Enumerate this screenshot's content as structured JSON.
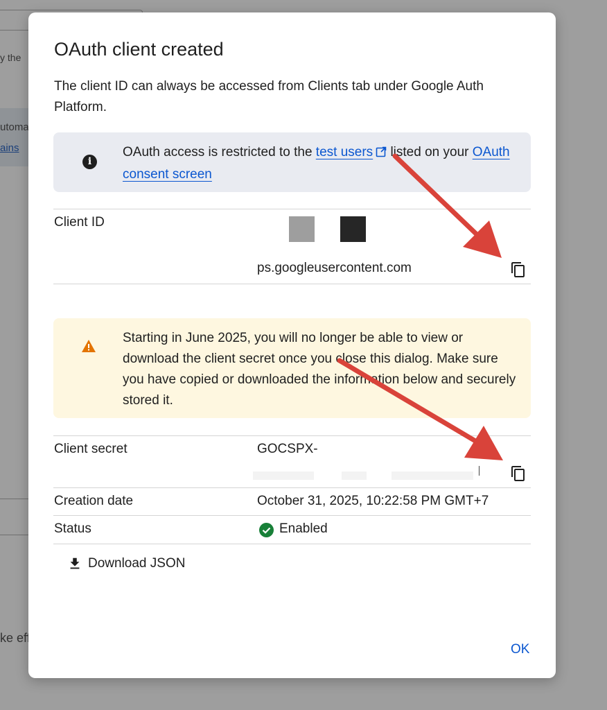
{
  "background": {
    "frag_1": "y the",
    "frag_2": "utoma",
    "frag_3": "ains",
    "frag_4": "ke eff"
  },
  "dialog": {
    "title": "OAuth client created",
    "description": "The client ID can always be accessed from Clients tab under Google Auth Platform.",
    "info": {
      "text_1": "OAuth access is restricted to the",
      "test_users_link": "test users",
      "text_2": "listed on your",
      "consent_link": "OAuth consent screen"
    },
    "client_id": {
      "label": "Client ID",
      "value": "ps.googleusercontent.com"
    },
    "warning": {
      "text": "Starting in June 2025, you will no longer be able to view or download the client secret once you close this dialog. Make sure you have copied or downloaded the information below and securely stored it."
    },
    "client_secret": {
      "label": "Client secret",
      "value": "GOCSPX-"
    },
    "creation_date": {
      "label": "Creation date",
      "value": "October 31, 2025, 10:22:58 PM GMT+7"
    },
    "status": {
      "label": "Status",
      "value": "Enabled"
    },
    "download_label": "Download JSON",
    "ok_label": "OK"
  },
  "icons": {
    "info": "info-icon",
    "external": "external-link-icon",
    "copy": "copy-icon",
    "warning": "warning-icon",
    "check": "check-circle-icon",
    "download": "download-icon"
  },
  "colors": {
    "link": "#0b57d0",
    "info_bg": "#e9ebf1",
    "warning_bg": "#fef7e0",
    "warning_icon": "#e37400",
    "enabled": "#188038",
    "annotation_arrow": "#d9433a"
  }
}
